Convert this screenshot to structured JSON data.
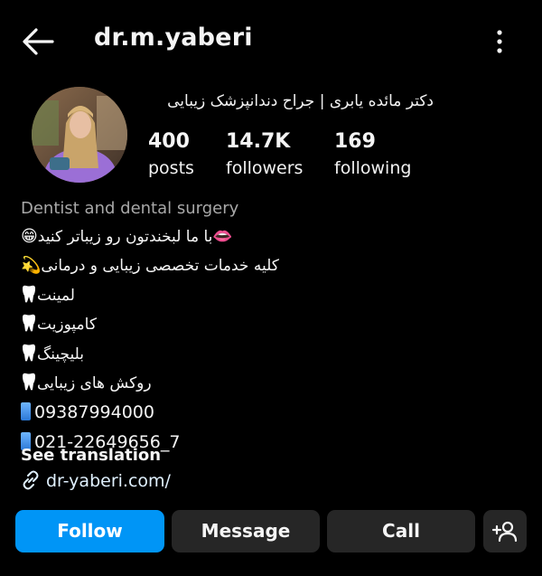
{
  "header": {
    "username": "dr.m.yaberi",
    "back_icon": "arrow-left-icon",
    "more_icon": "more-vertical-icon"
  },
  "profile": {
    "full_name": "دکتر مائده یابری | جراح دندانپزشک زیبایی",
    "stats": {
      "posts_count": "400",
      "posts_label": "posts",
      "followers_count": "14.7K",
      "followers_label": "followers",
      "following_count": "169",
      "following_label": "following"
    }
  },
  "bio": {
    "category": "Dentist and dental surgery",
    "line1_text": "با ما لبخندتون رو زیباتر کنید",
    "line1_emoji_start": "👄",
    "line1_emoji_end": "😁",
    "line2_text": "کلیه خدمات تخصصی زیبایی و درمانی",
    "line2_emoji": "💫",
    "line3_text": "لمینت",
    "line4_text": "کامپوزیت",
    "line5_text": "بلیچینگ",
    "line6_text": "روکش های زیبایی",
    "phone1": "09387994000",
    "phone2": "021-22649656_7",
    "see_translation": "See translation",
    "link": "dr-yaberi.com/"
  },
  "actions": {
    "follow": "Follow",
    "message": "Message",
    "call": "Call",
    "suggest_icon": "add-person-icon"
  },
  "colors": {
    "background": "#000000",
    "follow_blue": "#0095f6",
    "secondary_button": "#262626",
    "muted_text": "#a8a8a8"
  }
}
